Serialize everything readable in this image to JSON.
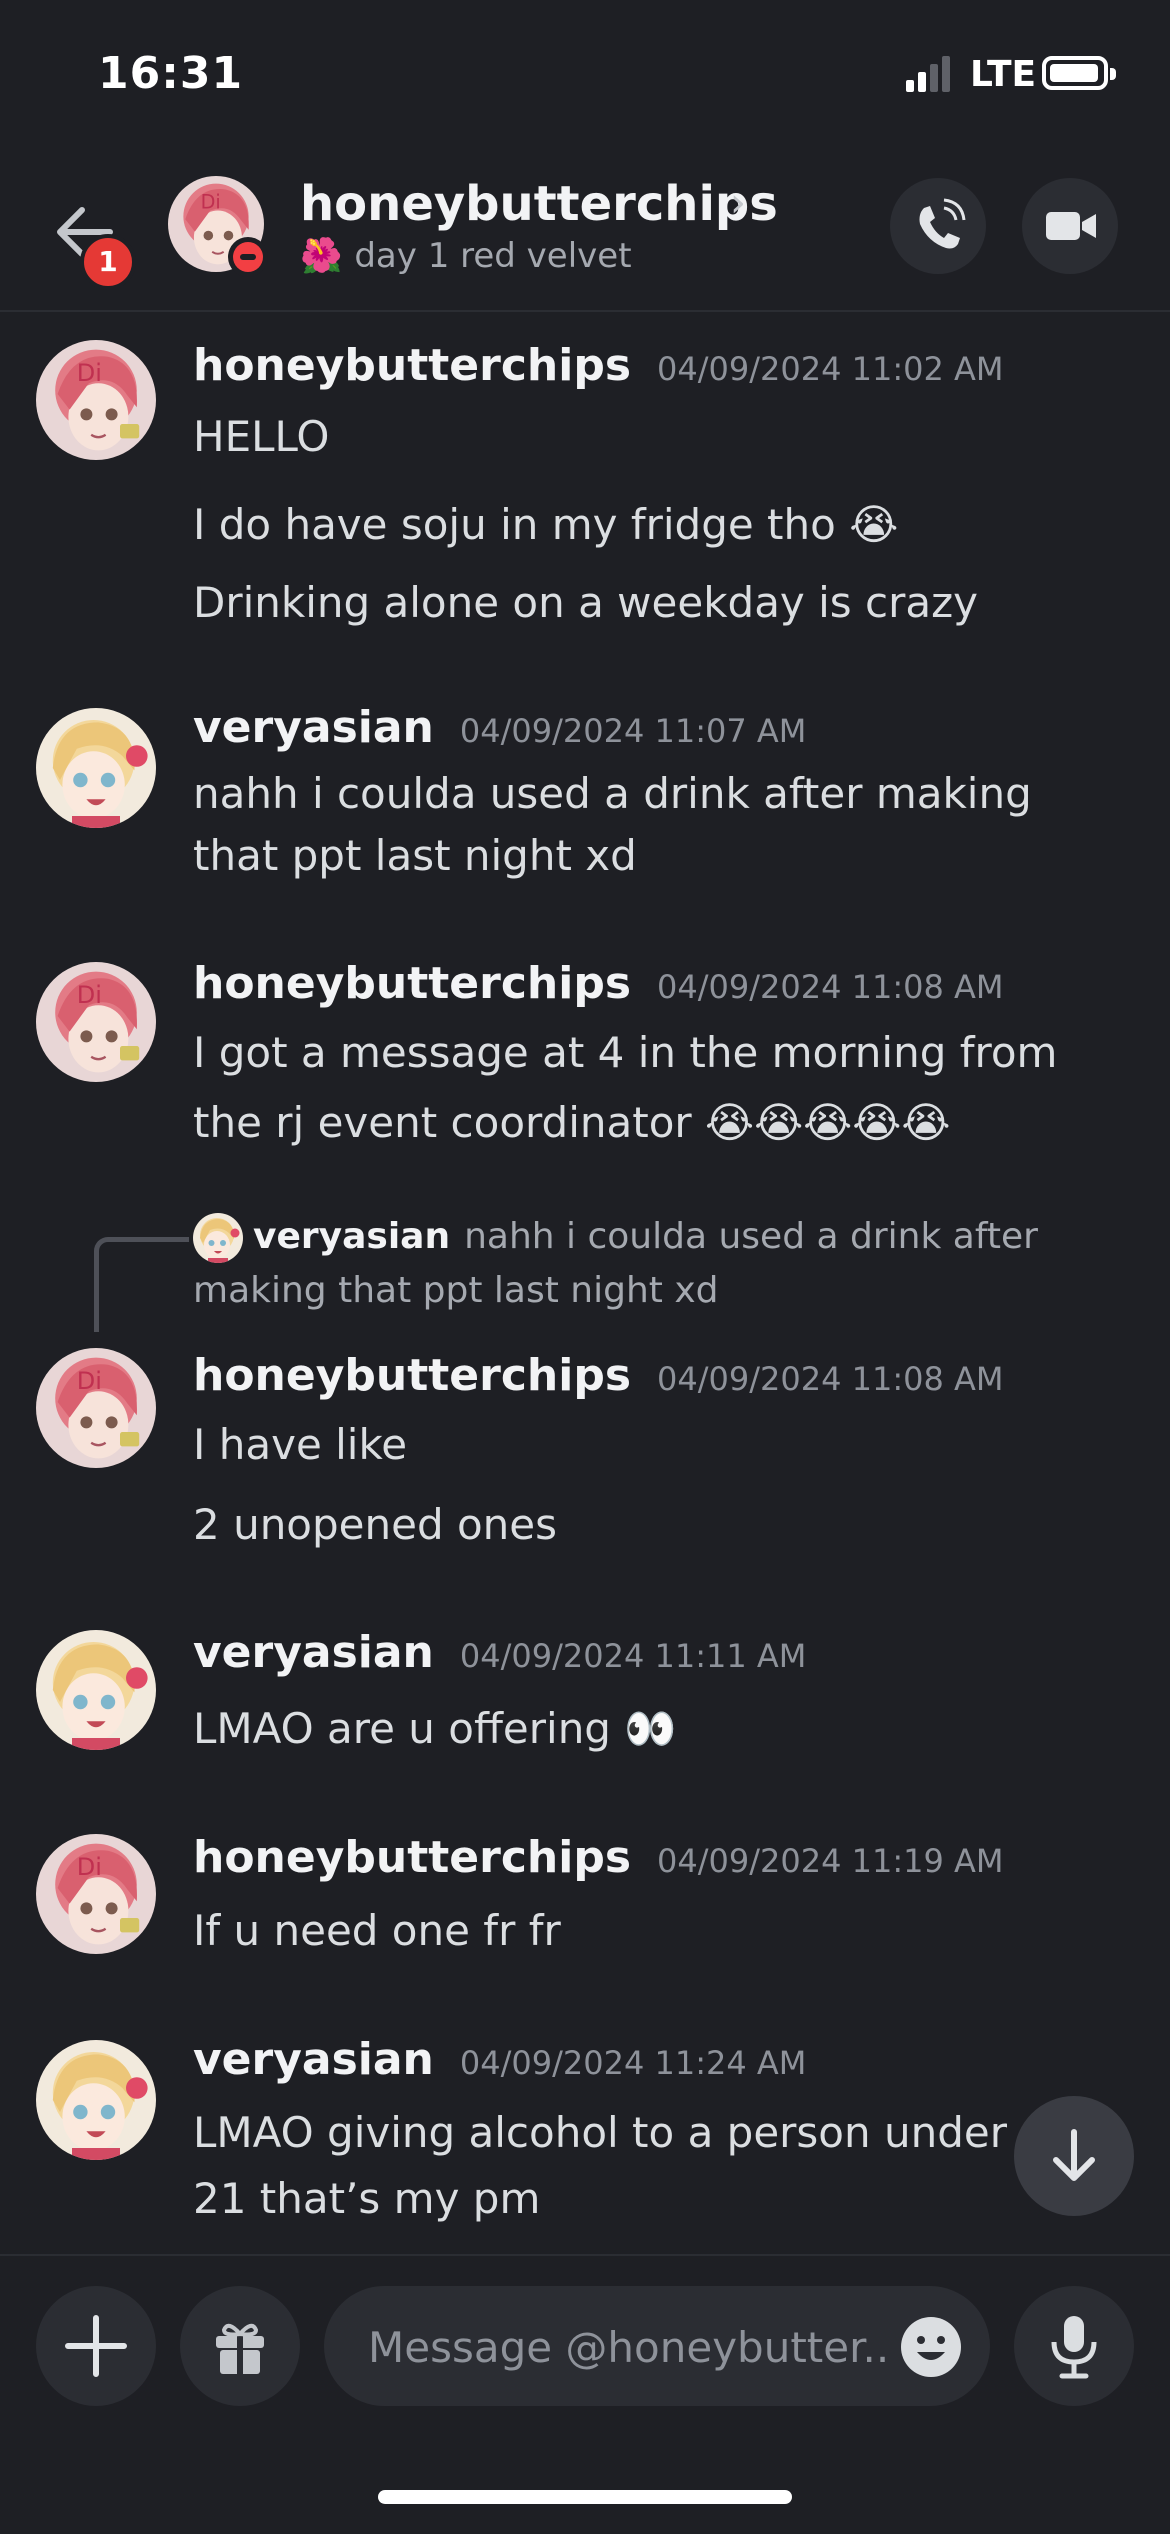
{
  "status_bar": {
    "time": "16:31",
    "network": "LTE"
  },
  "header": {
    "unread_badge": "1",
    "name": "honeybutterchips",
    "status": "day 1 red velvet",
    "status_emoji": "🌺"
  },
  "messages": [
    {
      "user": "honeybutterchips",
      "timestamp": "04/09/2024 11:02 AM",
      "lines": [
        "HELLO",
        "I do have soju in my fridge tho 😭",
        "Drinking alone on a weekday is crazy"
      ]
    },
    {
      "user": "veryasian",
      "timestamp": "04/09/2024 11:07 AM",
      "lines": [
        "nahh i coulda used a drink after making that ppt last night xd"
      ]
    },
    {
      "user": "honeybutterchips",
      "timestamp": "04/09/2024 11:08 AM",
      "lines": [
        "I got a message at 4 in the morning from the rj event coordinator 😭😭😭😭😭"
      ]
    },
    {
      "user": "honeybutterchips",
      "timestamp": "04/09/2024 11:08 AM",
      "reply_to": {
        "user": "veryasian",
        "text": "nahh i coulda used a drink after making that ppt last night xd"
      },
      "lines": [
        "I have like",
        "2 unopened ones"
      ]
    },
    {
      "user": "veryasian",
      "timestamp": "04/09/2024 11:11 AM",
      "lines": [
        "LMAO are u offering 👀"
      ]
    },
    {
      "user": "honeybutterchips",
      "timestamp": "04/09/2024 11:19 AM",
      "lines": [
        "If u need one fr fr"
      ]
    },
    {
      "user": "veryasian",
      "timestamp": "04/09/2024 11:24 AM",
      "lines": [
        "LMAO giving alcohol to a person under 21 that’s my pm"
      ]
    }
  ],
  "composer": {
    "placeholder": "Message @honeybutter.."
  },
  "icons": {
    "back": "arrow-left-icon",
    "call": "phone-icon",
    "video": "video-camera-icon",
    "plus": "plus-icon",
    "gift": "gift-icon",
    "emoji": "smiley-icon",
    "mic": "microphone-icon",
    "scroll": "arrow-down-icon"
  },
  "colors": {
    "background": "#1e1f24",
    "dnd": "#f23f43",
    "badge": "#e53935"
  }
}
